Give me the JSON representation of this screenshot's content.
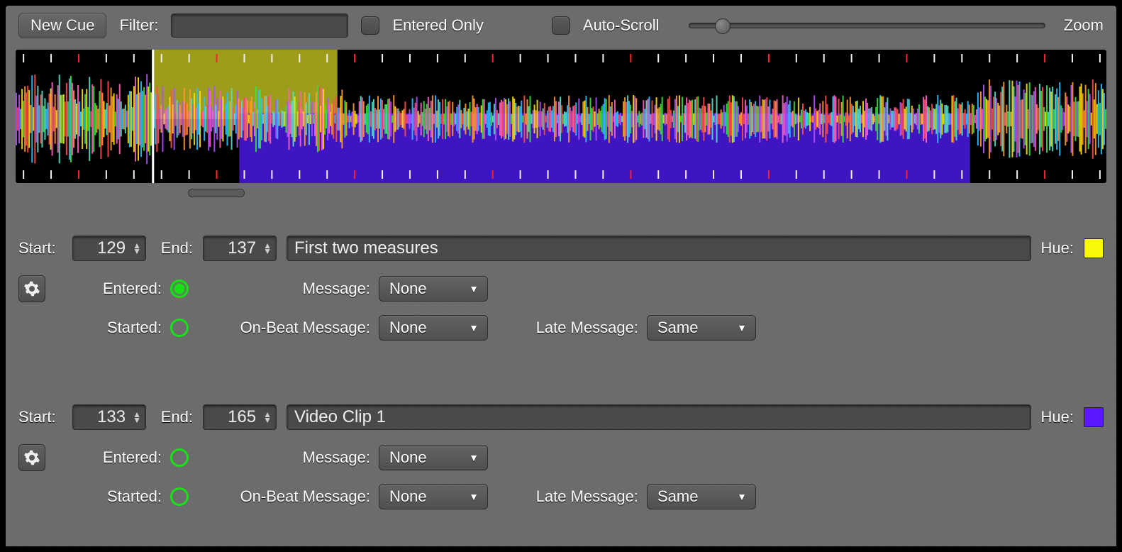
{
  "toolbar": {
    "new_cue_label": "New Cue",
    "filter_label": "Filter:",
    "filter_value": "",
    "entered_only_label": "Entered Only",
    "auto_scroll_label": "Auto-Scroll",
    "zoom_label": "Zoom",
    "zoom_value": 0.07
  },
  "waveform": {
    "playhead_pos": 0.125,
    "selection_yellow": {
      "start": 0.125,
      "end": 0.295,
      "color": "#c9c822"
    },
    "selection_purple": {
      "start": 0.205,
      "end": 0.875,
      "color": "#4a19e3"
    },
    "scrollbar": {
      "start": 0.158,
      "end": 0.21
    }
  },
  "labels": {
    "start": "Start:",
    "end": "End:",
    "hue": "Hue:",
    "entered": "Entered:",
    "started": "Started:",
    "message": "Message:",
    "on_beat_message": "On-Beat Message:",
    "late_message": "Late Message:"
  },
  "dropdown_options": {
    "message": "None",
    "late_message": "Same"
  },
  "cues": [
    {
      "start": 129,
      "end": 137,
      "name": "First two measures",
      "hue": "#f8f80a",
      "entered": true,
      "started": false,
      "message": "None",
      "on_beat_message": "None",
      "late_message": "Same"
    },
    {
      "start": 133,
      "end": 165,
      "name": "Video Clip 1",
      "hue": "#5a19ff",
      "entered": false,
      "started": false,
      "message": "None",
      "on_beat_message": "None",
      "late_message": "Same"
    }
  ]
}
